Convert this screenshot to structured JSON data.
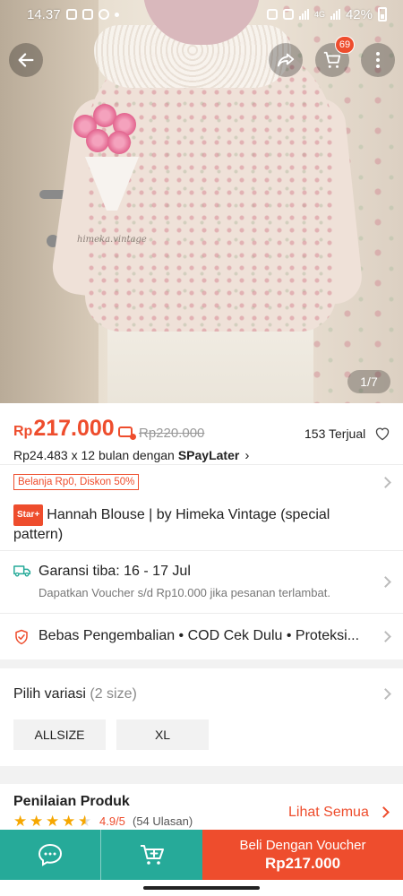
{
  "status_bar": {
    "time": "14.37",
    "network": "4G",
    "battery": "42%"
  },
  "hero": {
    "watermark": "himeka.vintage",
    "image_counter": "1/7",
    "cart_badge": "69"
  },
  "icons": {
    "back": "arrow-left-icon",
    "share": "share-icon",
    "cart": "cart-icon",
    "more": "more-vertical-icon",
    "heart": "heart-icon",
    "shipping": "truck-icon",
    "guarantee": "shield-icon",
    "chat": "chat-icon",
    "add_cart": "add-to-cart-icon"
  },
  "product": {
    "price_currency": "Rp",
    "price_value": "217.000",
    "old_price": "Rp220.000",
    "sold": "153 Terjual",
    "installment_text": "Rp24.483 x 12 bulan dengan",
    "installment_brand": "SPayLater",
    "promo_badge": "Belanja Rp0, Diskon 50%",
    "star_badge": "Star+",
    "title": "Hannah Blouse | by Himeka Vintage (special pattern)"
  },
  "shipping": {
    "title": "Garansi tiba: 16 - 17 Jul",
    "subtitle": "Dapatkan Voucher s/d Rp10.000 jika pesanan terlambat."
  },
  "guarantees": {
    "text": "Bebas Pengembalian  •  COD Cek Dulu  •  Proteksi..."
  },
  "variation": {
    "label": "Pilih variasi",
    "count": "(2 size)",
    "options": [
      "ALLSIZE",
      "XL"
    ]
  },
  "reviews": {
    "title": "Penilaian Produk",
    "see_all": "Lihat Semua",
    "rating": "4.9/5",
    "count": "(54 Ulasan)"
  },
  "bottom_bar": {
    "buy_label": "Beli Dengan Voucher",
    "buy_price": "Rp217.000"
  },
  "colors": {
    "accent": "#ee4d2d",
    "teal": "#26aa99",
    "star": "#f6a700"
  }
}
